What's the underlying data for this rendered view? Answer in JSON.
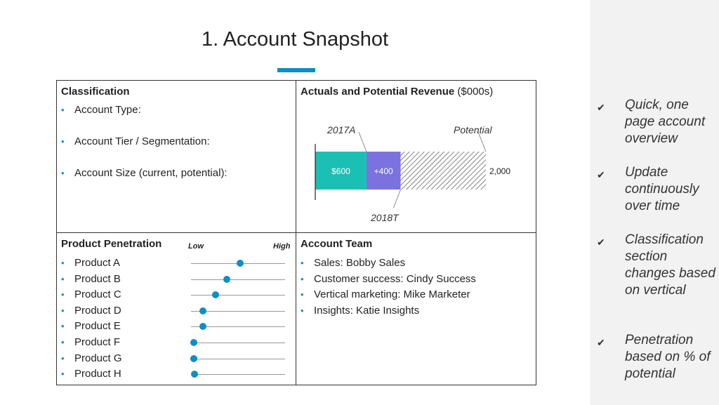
{
  "title": "1. Account Snapshot",
  "accent_color": "#0a8fc9",
  "classification": {
    "heading": "Classification",
    "items": [
      "Account Type:",
      "Account Tier / Segmentation:",
      "Account Size (current, potential):"
    ]
  },
  "revenue": {
    "heading_bold": "Actuals and Potential Revenue",
    "heading_unit": "($000s)",
    "chart_data": {
      "type": "bar",
      "stacked": true,
      "orientation": "horizontal",
      "segments": [
        {
          "label": "2017A",
          "value": 600,
          "data_label": "$600",
          "color": "#1cbfb3"
        },
        {
          "label": "2018T",
          "value": 400,
          "data_label": "+400",
          "color": "#7b72e0"
        },
        {
          "label": "Potential",
          "value": 1000,
          "pattern": "hatched"
        }
      ],
      "total_label": "2,000",
      "total": 2000
    }
  },
  "penetration": {
    "heading": "Product Penetration",
    "low": "Low",
    "high": "High",
    "products": [
      {
        "name": "Product A",
        "level": 0.52
      },
      {
        "name": "Product B",
        "level": 0.38
      },
      {
        "name": "Product C",
        "level": 0.26
      },
      {
        "name": "Product D",
        "level": 0.13
      },
      {
        "name": "Product E",
        "level": 0.13
      },
      {
        "name": "Product F",
        "level": 0.03
      },
      {
        "name": "Product G",
        "level": 0.03
      },
      {
        "name": "Product H",
        "level": 0.04
      }
    ]
  },
  "team": {
    "heading": "Account Team",
    "items": [
      "Sales: Bobby Sales",
      "Customer success: Cindy Success",
      "Vertical marketing: Mike Marketer",
      "Insights: Katie Insights"
    ]
  },
  "side": {
    "check": "✔",
    "items": [
      "Quick, one page account overview",
      "Update continuously over time",
      "Classification section changes based on vertical",
      "Penetration based on % of potential"
    ]
  }
}
